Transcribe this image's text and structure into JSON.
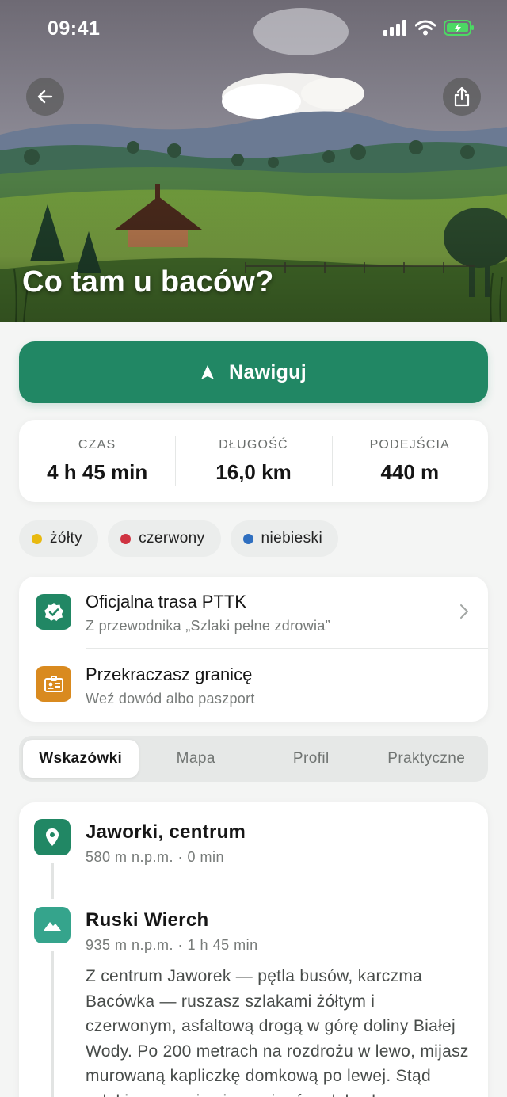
{
  "status_bar": {
    "time": "09:41"
  },
  "hero": {
    "title": "Co tam u baców?"
  },
  "navigate_button": {
    "label": "Nawiguj"
  },
  "stats": [
    {
      "key": "CZAS",
      "value": "4 h 45 min"
    },
    {
      "key": "DŁUGOŚĆ",
      "value": "16,0 km"
    },
    {
      "key": "PODEJŚCIA",
      "value": "440 m"
    }
  ],
  "trail_colors": [
    {
      "label": "żółty",
      "color": "#e8b90f"
    },
    {
      "label": "czerwony",
      "color": "#cf3341"
    },
    {
      "label": "niebieski",
      "color": "#2f6fc0"
    }
  ],
  "info": {
    "official": {
      "title": "Oficjalna trasa PTTK",
      "subtitle": "Z przewodnika „Szlaki pełne zdrowia”"
    },
    "border": {
      "title": "Przekraczasz granicę",
      "subtitle": "Weź dowód albo paszport"
    }
  },
  "tabs": [
    {
      "label": "Wskazówki",
      "active": true
    },
    {
      "label": "Mapa",
      "active": false
    },
    {
      "label": "Profil",
      "active": false
    },
    {
      "label": "Praktyczne",
      "active": false
    }
  ],
  "route": {
    "stops": [
      {
        "name": "Jaworki, centrum",
        "meta": "580 m n.p.m. · 0 min",
        "icon": "location-pin-icon"
      },
      {
        "name": "Ruski Wierch",
        "meta": "935 m n.p.m. · 1 h 45 min",
        "icon": "mountain-icon",
        "description": "Z centrum Jaworek — pętla busów, karczma Bacówka — ruszasz szlakami żółtym i czerwonym, asfaltową drogą w górę doliny Białej Wody. Po 200 metrach na rozdrożu w lewo, mijasz murowaną kapliczkę domkową po lewej. Stąd szlaki zaczynają się wspinać po łąkach."
      }
    ]
  },
  "colors": {
    "accent": "#218764",
    "warning": "#d98a1f",
    "teal": "#35a48c"
  }
}
